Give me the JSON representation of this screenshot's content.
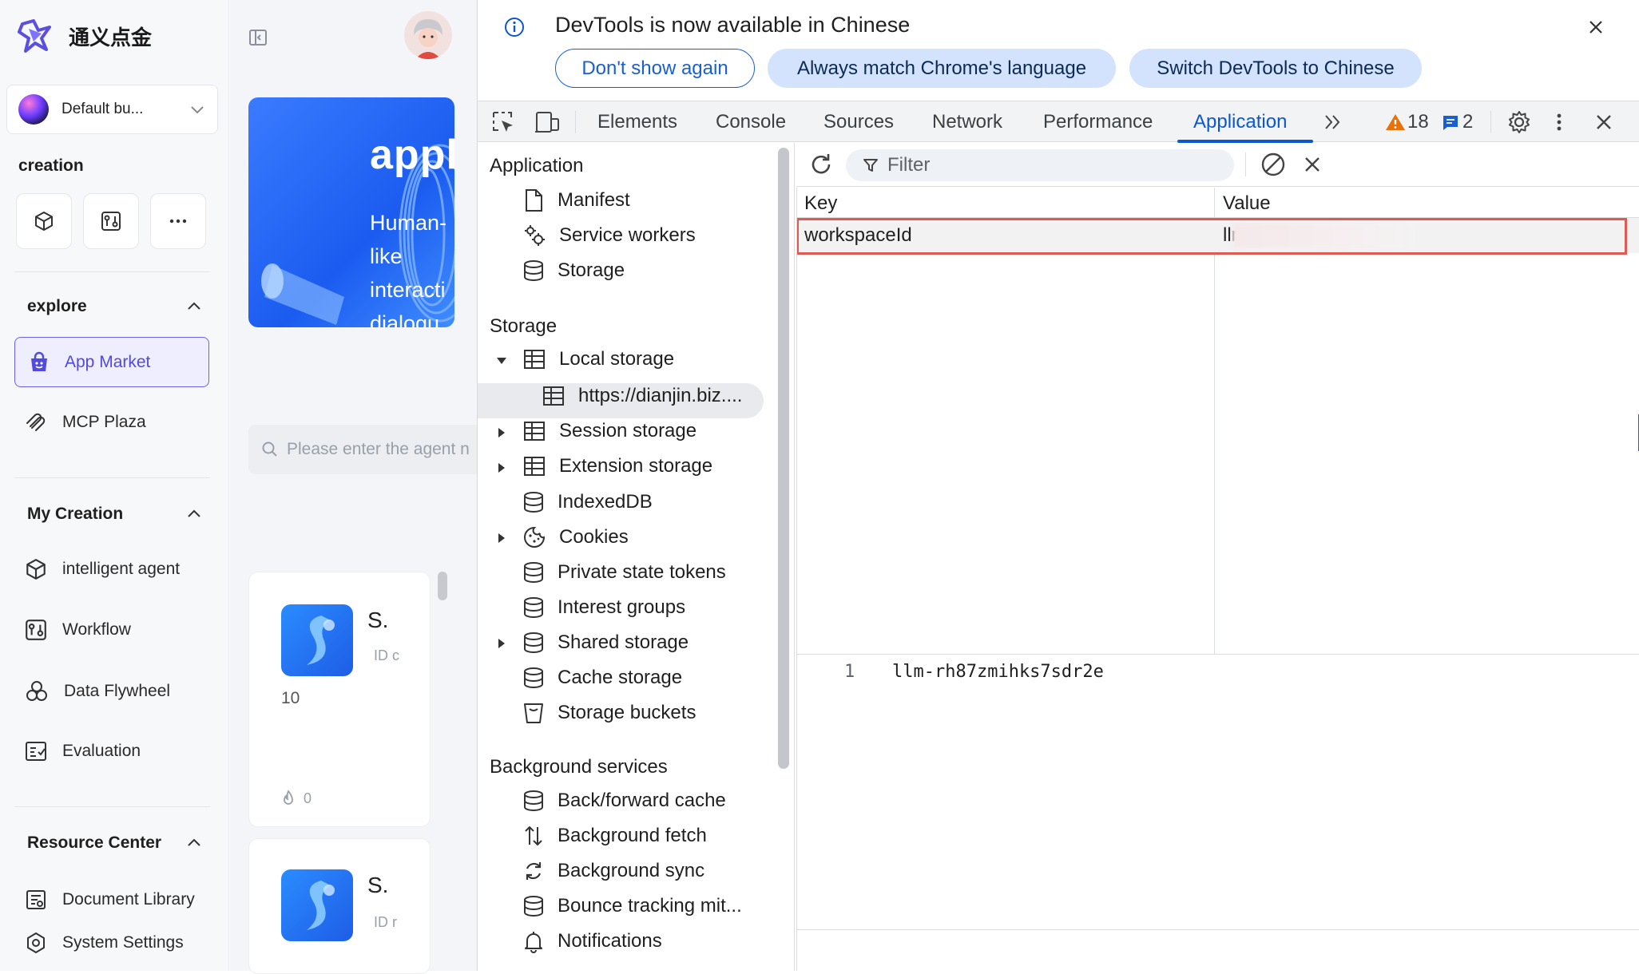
{
  "app": {
    "brand_name": "通义点金",
    "business_selector": "Default bu...",
    "creation_title": "creation",
    "explore": {
      "title": "explore",
      "items": [
        {
          "label": "App Market",
          "active": true
        },
        {
          "label": "MCP Plaza",
          "active": false
        }
      ]
    },
    "my_creation": {
      "title": "My Creation",
      "items": [
        {
          "label": "intelligent agent"
        },
        {
          "label": "Workflow"
        },
        {
          "label": "Data Flywheel"
        },
        {
          "label": "Evaluation"
        }
      ]
    },
    "resource_center": {
      "title": "Resource Center",
      "items": [
        {
          "label": "Document Library"
        },
        {
          "label": "System Settings"
        }
      ]
    }
  },
  "middle": {
    "banner": {
      "title": "appli",
      "lines": [
        "Human-",
        "like",
        "interacti",
        "dialogu"
      ]
    },
    "search_placeholder": "Please enter the agent n",
    "cards": [
      {
        "title": "S.",
        "id_text": "ID c",
        "number": "10",
        "likes": "0"
      },
      {
        "title": "S.",
        "id_text": "ID r"
      }
    ]
  },
  "devtools": {
    "infobar": {
      "message": "DevTools is now available in Chinese",
      "btn_dont_show": "Don't show again",
      "btn_match": "Always match Chrome's language",
      "btn_switch": "Switch DevTools to Chinese"
    },
    "tabs": [
      "Elements",
      "Console",
      "Sources",
      "Network",
      "Performance",
      "Application"
    ],
    "active_tab": "Application",
    "warnings_count": "18",
    "messages_count": "2",
    "tree": {
      "application_header": "Application",
      "application_items": [
        "Manifest",
        "Service workers",
        "Storage"
      ],
      "storage_header": "Storage",
      "storage_items": [
        "Local storage",
        "https://dianjin.biz....",
        "Session storage",
        "Extension storage",
        "IndexedDB",
        "Cookies",
        "Private state tokens",
        "Interest groups",
        "Shared storage",
        "Cache storage",
        "Storage buckets"
      ],
      "background_header": "Background services",
      "background_items": [
        "Back/forward cache",
        "Background fetch",
        "Background sync",
        "Bounce tracking mit...",
        "Notifications"
      ]
    },
    "storage_table": {
      "filter_placeholder": "Filter",
      "columns": [
        "Key",
        "Value"
      ],
      "rows": [
        {
          "key": "workspaceId",
          "value": "llm-"
        }
      ],
      "preview": {
        "line_number": "1",
        "content": "llm-rh87zmihks7sdr2e"
      }
    },
    "colors": {
      "accent": "#0b57d0",
      "highlight": "#e05a52",
      "brand": "#5249de"
    }
  }
}
